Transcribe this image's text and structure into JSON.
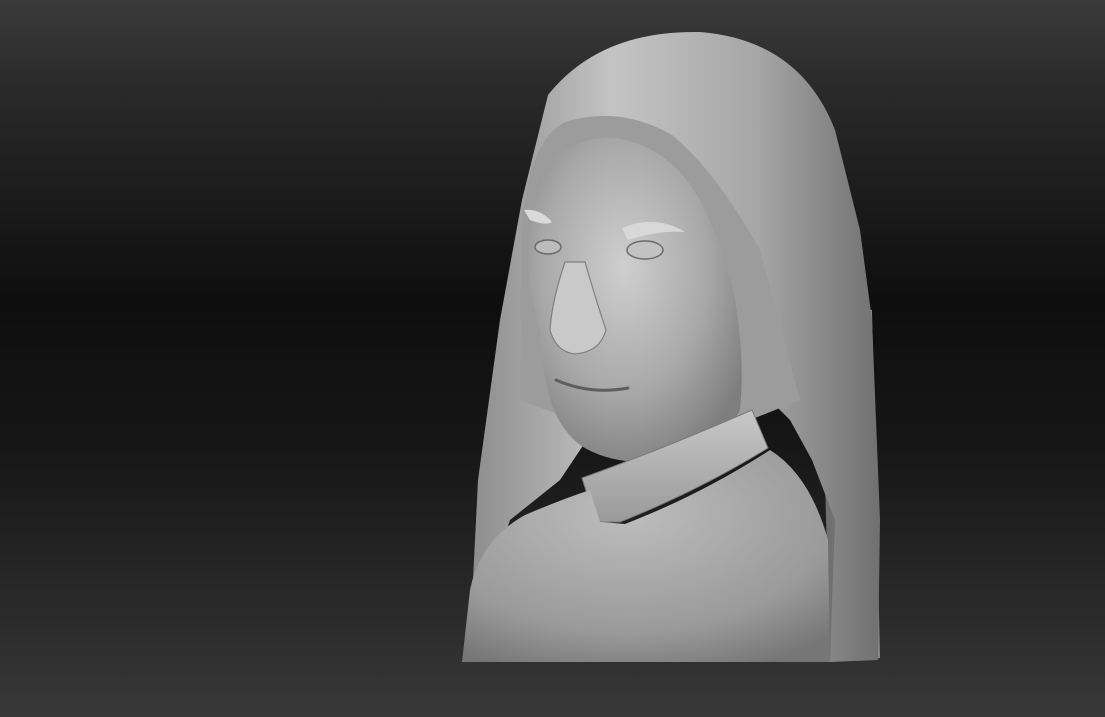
{
  "scene": {
    "subject_icon": "sculpted-bust-icon",
    "colors": {
      "background_top": "#3a3a3a",
      "background_middle": "#0e0e0e",
      "background_bottom": "#383838",
      "clay": "#a8a8a8"
    }
  }
}
